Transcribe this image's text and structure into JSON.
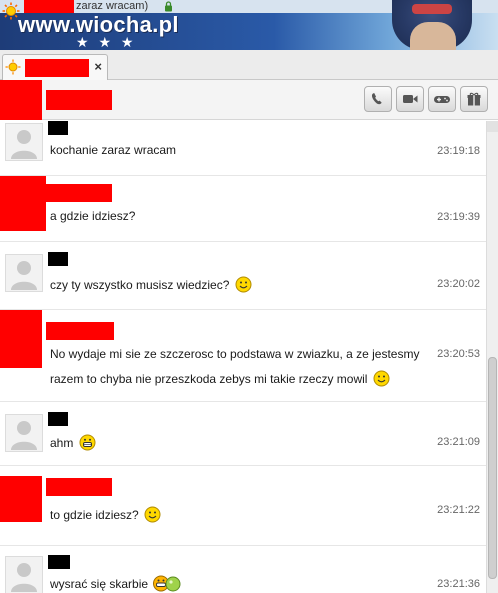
{
  "window": {
    "status_text": "zaraz wracam)",
    "watermark": "www.wiocha.pl",
    "stars": "★ ★ ★"
  },
  "toolbar": {
    "tab_close_label": "×",
    "actions": [
      {
        "icon": "phone-icon"
      },
      {
        "icon": "video-camera-icon"
      },
      {
        "icon": "gamepad-icon"
      },
      {
        "icon": "gift-icon"
      }
    ]
  },
  "messages": [
    {
      "sender": "contact",
      "lines": [
        "kochanie zaraz wracam"
      ],
      "emoticon": "",
      "time": "23:19:18"
    },
    {
      "sender": "self",
      "lines": [
        "a gdzie idziesz?"
      ],
      "emoticon": "",
      "time": "23:19:39"
    },
    {
      "sender": "contact",
      "lines": [
        "czy ty wszystko musisz wiedziec?"
      ],
      "emoticon": "smile-emoticon",
      "time": "23:20:02"
    },
    {
      "sender": "self",
      "lines": [
        "No wydaje mi sie ze szczerosc to podstawa w zwiazku, a ze jestesmy",
        "razem to chyba nie przeszkoda zebys mi takie rzeczy mowil"
      ],
      "emoticon": "smile-emoticon",
      "time": "23:20:53"
    },
    {
      "sender": "contact",
      "lines": [
        "ahm"
      ],
      "emoticon": "grin-emoticon",
      "time": "23:21:09"
    },
    {
      "sender": "self",
      "lines": [
        "to gdzie idziesz?"
      ],
      "emoticon": "smile-emoticon",
      "time": "23:21:22"
    },
    {
      "sender": "contact",
      "lines": [
        "wysrać się skarbie"
      ],
      "emoticon": "poop-emoticon",
      "time": "23:21:36"
    }
  ],
  "colors": {
    "redaction": "#ff0000",
    "banner": "#2a5aa8",
    "timestamp": "#666666"
  }
}
